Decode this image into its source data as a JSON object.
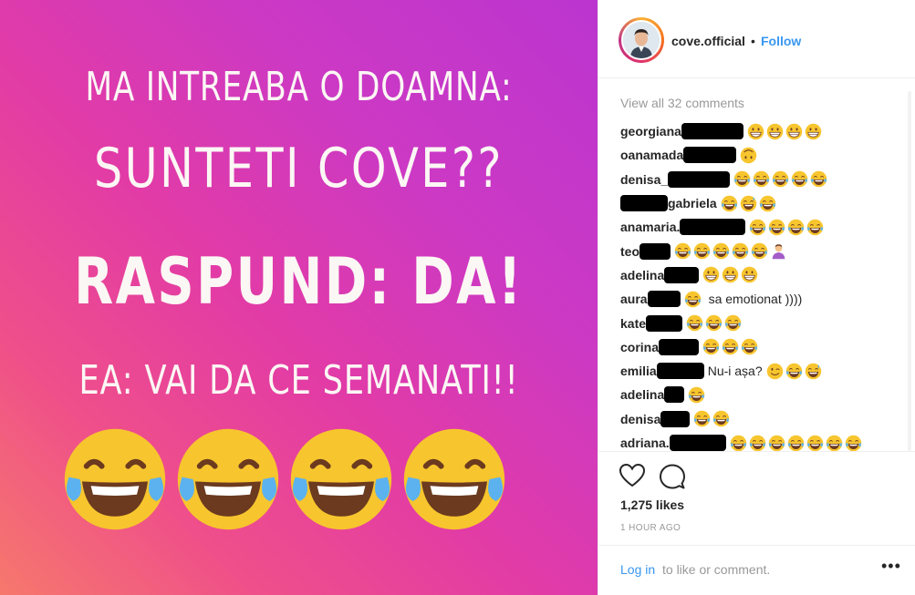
{
  "post_image": {
    "lines": [
      "MA INTREABA O DOAMNA:",
      "SUNTETI COVE??",
      "RASPUND: DA!",
      "EA: VAI DA CE SEMANATI!!"
    ],
    "emojis": [
      "joy-emoji",
      "joy-emoji",
      "joy-emoji",
      "joy-emoji"
    ]
  },
  "header": {
    "username": "cove.official",
    "separator": "•",
    "follow": "Follow"
  },
  "comments": {
    "view_all": "View all 32 comments",
    "items": [
      {
        "user": "georgiana",
        "text": "",
        "emojis": [
          "grin",
          "grin",
          "grin",
          "grin"
        ]
      },
      {
        "user": "oanamada",
        "text": "",
        "emojis": [
          "upside-down"
        ]
      },
      {
        "user": "denisa_",
        "text": "",
        "emojis": [
          "joy",
          "joy",
          "joy",
          "joy",
          "joy"
        ]
      },
      {
        "user": "gabriela",
        "text": "",
        "emojis": [
          "joy",
          "sweat-smile",
          "rofl"
        ]
      },
      {
        "user": "anamaria.",
        "text": "",
        "emojis": [
          "joy",
          "joy",
          "joy",
          "joy"
        ]
      },
      {
        "user": "teo",
        "text": "",
        "emojis": [
          "joy",
          "joy",
          "joy",
          "joy",
          "joy",
          "facepalm"
        ]
      },
      {
        "user": "adelina",
        "text": "",
        "emojis": [
          "grin",
          "grin",
          "grin"
        ]
      },
      {
        "user": "aura",
        "text": "sa emotionat ))))",
        "emojis": [
          "joy"
        ]
      },
      {
        "user": "kate",
        "text": "",
        "emojis": [
          "rofl",
          "rofl",
          "rofl"
        ]
      },
      {
        "user": "corina",
        "text": "",
        "emojis": [
          "rofl",
          "rofl",
          "rofl"
        ]
      },
      {
        "user": "emilia",
        "text": "Nu-i așa?",
        "emojis": [
          "wink",
          "joy",
          "sweat-smile"
        ]
      },
      {
        "user": "adelina",
        "text": "",
        "emojis": [
          "joy"
        ]
      },
      {
        "user": "denisa",
        "text": "",
        "emojis": [
          "joy",
          "joy"
        ]
      },
      {
        "user": "adriana.",
        "text": "",
        "emojis": [
          "joy",
          "joy",
          "joy",
          "joy",
          "joy",
          "joy",
          "joy"
        ]
      }
    ]
  },
  "actions": {
    "likes": "1,275 likes",
    "time": "1 HOUR AGO"
  },
  "footer": {
    "login": "Log in",
    "login_rest": "to like or comment.",
    "more": "•••"
  },
  "colors": {
    "link_blue": "#3897f0",
    "text": "#262626",
    "muted": "#999999"
  }
}
